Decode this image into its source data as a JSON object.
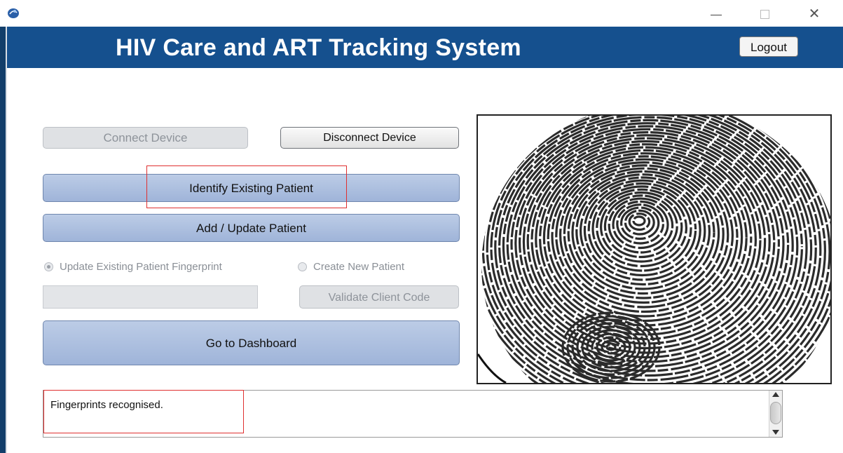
{
  "window": {
    "icon": "app-logo-icon",
    "controls": {
      "minimize": "minimize-icon",
      "maximize": "maximize-icon",
      "close": "close-icon"
    }
  },
  "header": {
    "title": "HIV Care and ART Tracking System",
    "logout_label": "Logout"
  },
  "device": {
    "connect_label": "Connect Device",
    "disconnect_label": "Disconnect Device"
  },
  "actions": {
    "identify_label": "Identify Existing Patient",
    "add_update_label": "Add / Update Patient",
    "dashboard_label": "Go to Dashboard"
  },
  "patient_mode": {
    "option_update": "Update Existing Patient Fingerprint",
    "option_create": "Create New Patient",
    "selected": "option_update"
  },
  "client_code": {
    "value": "",
    "validate_label": "Validate Client Code"
  },
  "fingerprint": {
    "icon": "fingerprint-image"
  },
  "status": {
    "message": "Fingerprints recognised."
  },
  "colors": {
    "header_bg": "#15508e",
    "button_blue": "#a9bcdd",
    "highlight": "#e03030"
  }
}
